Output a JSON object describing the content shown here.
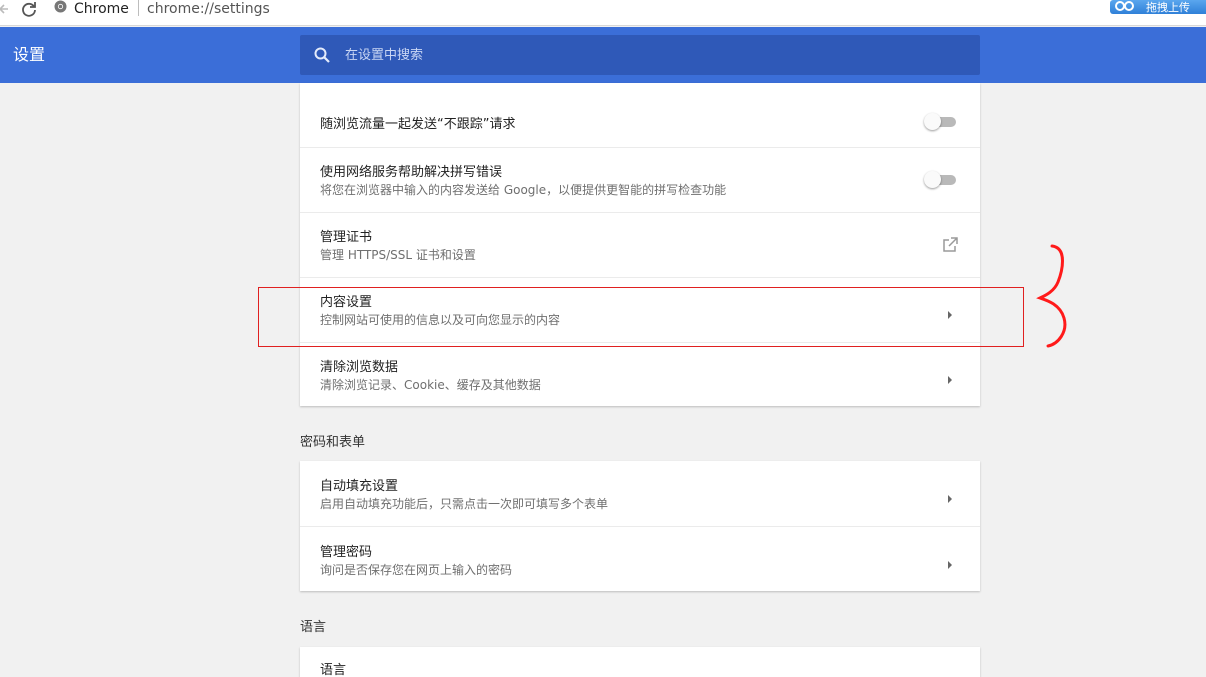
{
  "browser": {
    "tab_label": "Chrome",
    "url": "chrome://settings",
    "extension_label": "拖拽上传"
  },
  "header": {
    "title": "设置",
    "search_placeholder": "在设置中搜索"
  },
  "privacy_rows": [
    {
      "title": "随浏览流量一起发送“不跟踪”请求",
      "control": "toggle",
      "toggle_on": false
    },
    {
      "title": "使用网络服务帮助解决拼写错误",
      "subtitle": "将您在浏览器中输入的内容发送给 Google，以便提供更智能的拼写检查功能",
      "control": "toggle",
      "toggle_on": false
    },
    {
      "title": "管理证书",
      "subtitle": "管理 HTTPS/SSL 证书和设置",
      "control": "external-link"
    },
    {
      "title": "内容设置",
      "subtitle": "控制网站可使用的信息以及可向您显示的内容",
      "control": "arrow"
    },
    {
      "title": "清除浏览数据",
      "subtitle": "清除浏览记录、Cookie、缓存及其他数据",
      "control": "arrow"
    }
  ],
  "passwords_section": {
    "label": "密码和表单",
    "rows": [
      {
        "title": "自动填充设置",
        "subtitle": "启用自动填充功能后，只需点击一次即可填写多个表单",
        "control": "arrow"
      },
      {
        "title": "管理密码",
        "subtitle": "询问是否保存您在网页上输入的密码",
        "control": "arrow"
      }
    ]
  },
  "language_section": {
    "label": "语言",
    "rows": [
      {
        "title": "语言"
      }
    ]
  },
  "colors": {
    "header_blue": "#3b6ed8",
    "search_bg": "#2f59b8",
    "annotation_red": "#e02020"
  },
  "icons": {
    "search": "search-icon",
    "external": "external-link-icon",
    "arrow": "arrow-right-icon"
  }
}
